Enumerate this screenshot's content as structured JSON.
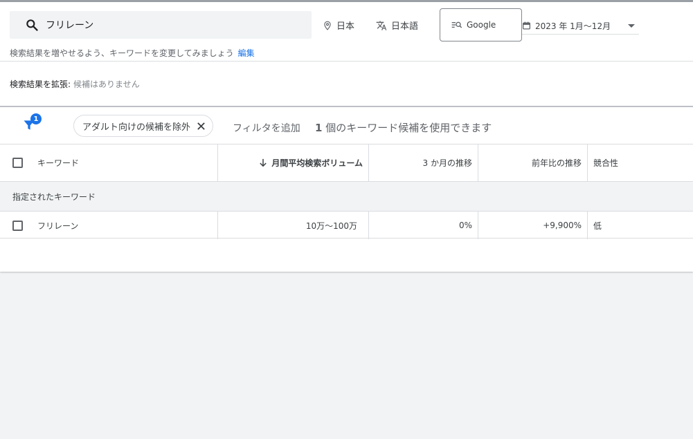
{
  "search": {
    "value": "フリレーン",
    "icon": "search-icon"
  },
  "location": {
    "label": "日本",
    "icon": "location-pin-icon"
  },
  "language": {
    "label": "日本語",
    "icon": "translate-icon"
  },
  "network": {
    "label": "Google",
    "icon": "search-network-icon"
  },
  "date_range": {
    "label": "2023 年 1月～12月",
    "icon": "calendar-icon"
  },
  "hint": {
    "text": "検索結果を増やせるよう、キーワードを変更してみましょう",
    "edit_label": "編集"
  },
  "expand": {
    "label": "検索結果を拡張:",
    "value": "候補はありません"
  },
  "filters": {
    "badge_count": "1",
    "chip_label": "アダルト向けの候補を除外",
    "add_filter_label": "フィルタを追加",
    "summary_count": "1",
    "summary_text": "個のキーワード候補を使用できます"
  },
  "table": {
    "headers": {
      "keyword": "キーワード",
      "volume": "月間平均検索ボリューム",
      "three_month": "3 か月の推移",
      "yoy": "前年比の推移",
      "competition": "競合性"
    },
    "group_label": "指定されたキーワード",
    "rows": [
      {
        "keyword": "フリレーン",
        "volume": "10万～100万",
        "three_month": "0%",
        "yoy": "+9,900%",
        "competition": "低"
      }
    ]
  },
  "colors": {
    "accent": "#1a73e8",
    "panel": "#ffffff",
    "background": "#f1f3f4"
  }
}
